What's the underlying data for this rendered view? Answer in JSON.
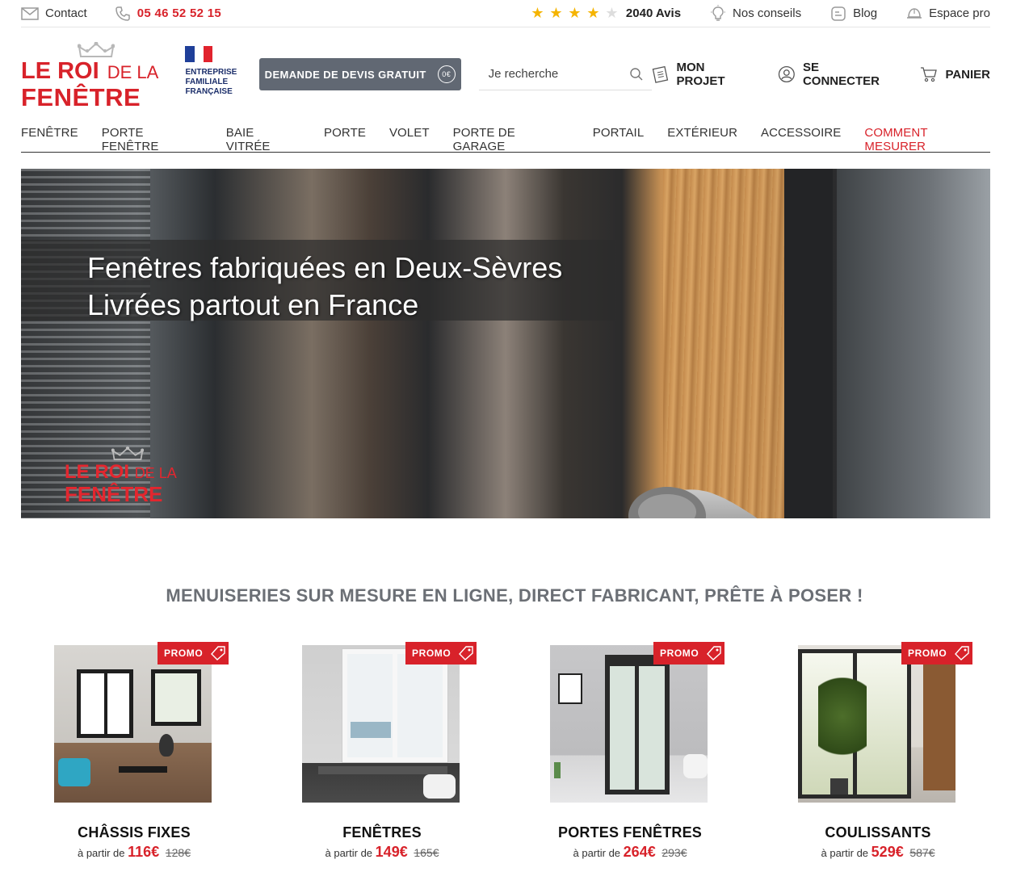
{
  "topbar": {
    "contact_label": "Contact",
    "phone": "05 46 52 52 15",
    "rating": {
      "stars_filled": 4,
      "stars_total": 5,
      "reviews_label": "2040 Avis"
    },
    "conseils_label": "Nos conseils",
    "blog_label": "Blog",
    "pro_label": "Espace pro"
  },
  "brand": {
    "logo_line1_a": "LE ROI",
    "logo_line1_b": "DE LA",
    "logo_line2": "FENÊTRE",
    "family_line1": "ENTREPRISE",
    "family_line2": "FAMILIALE",
    "family_line3": "FRANÇAISE",
    "accent_color": "#d8222a",
    "flag_colors": [
      "#1f3f99",
      "#ffffff",
      "#e1232d"
    ]
  },
  "header": {
    "devis_label": "DEMANDE DE DEVIS GRATUIT",
    "devis_icon_text": "0€",
    "search_placeholder": "Je recherche",
    "projet_label": "MON PROJET",
    "connect_label": "SE CONNECTER",
    "panier_label": "PANIER"
  },
  "nav": {
    "items": [
      "FENÊTRE",
      "PORTE FENÊTRE",
      "BAIE VITRÉE",
      "PORTE",
      "VOLET",
      "PORTE DE GARAGE",
      "PORTAIL",
      "EXTÉRIEUR",
      "ACCESSOIRE"
    ],
    "measure_label": "COMMENT MESURER"
  },
  "hero": {
    "line1": "Fenêtres fabriquées en Deux-Sèvres",
    "line2": "Livrées partout en France",
    "logo_line1_a": "LE ROI",
    "logo_line1_b": "DE LA",
    "logo_line2": "FENÊTRE"
  },
  "section": {
    "title": "MENUISERIES SUR MESURE EN LIGNE, DIRECT FABRICANT, PRÊTE À POSER !"
  },
  "products": [
    {
      "promo": "PROMO",
      "name": "CHÂSSIS FIXES",
      "prefix": "à partir de",
      "price": "116€",
      "old_price": "128€"
    },
    {
      "promo": "PROMO",
      "name": "FENÊTRES",
      "prefix": "à partir de",
      "price": "149€",
      "old_price": "165€"
    },
    {
      "promo": "PROMO",
      "name": "PORTES FENÊTRES",
      "prefix": "à partir de",
      "price": "264€",
      "old_price": "293€"
    },
    {
      "promo": "PROMO",
      "name": "COULISSANTS",
      "prefix": "à partir de",
      "price": "529€",
      "old_price": "587€"
    }
  ]
}
